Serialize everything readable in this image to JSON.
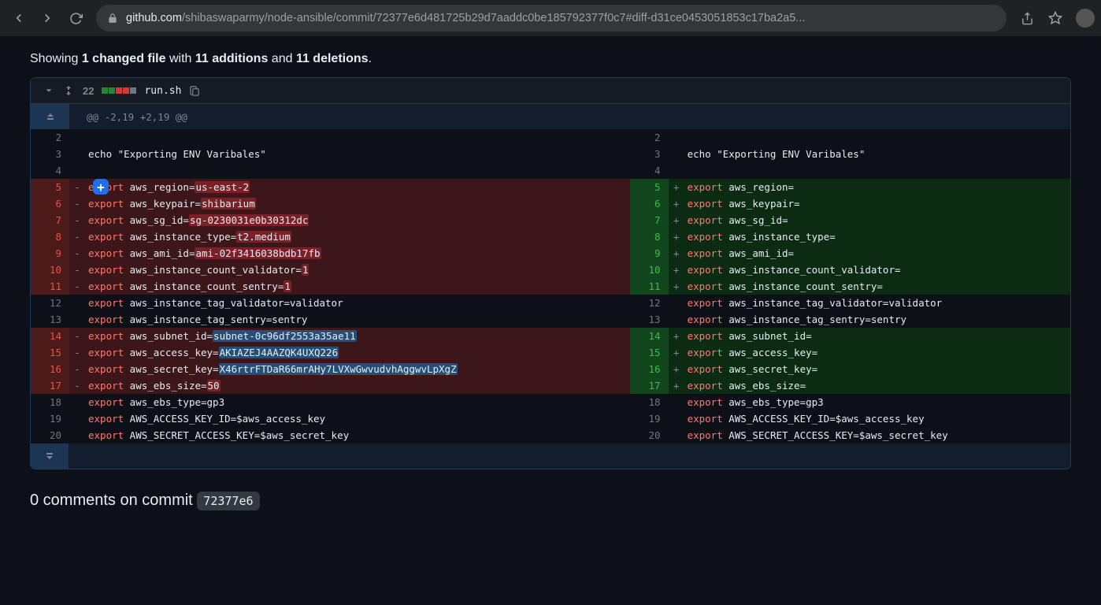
{
  "browser": {
    "url_prefix": "github.com",
    "url_path": "/shibaswaparmy/node-ansible/commit/72377e6d481725b29d7aaddc0be185792377f0c7#diff-d31ce0453051853c17ba2a5..."
  },
  "summary": {
    "prefix": "Showing ",
    "files": "1 changed file",
    "mid1": " with ",
    "adds": "11 additions",
    "mid2": " and ",
    "dels": "11 deletions",
    "suffix": "."
  },
  "file": {
    "stat_count": "22",
    "name": "run.sh"
  },
  "hunk": "@@ -2,19 +2,19 @@",
  "left": [
    {
      "n": "2",
      "m": "",
      "t": "ctx",
      "code": ""
    },
    {
      "n": "3",
      "m": "",
      "t": "ctx",
      "code": "echo \"Exporting ENV Varibales\"",
      "kw": false
    },
    {
      "n": "4",
      "m": "",
      "t": "ctx",
      "code": ""
    },
    {
      "n": "5",
      "m": "-",
      "t": "del",
      "pre": "export",
      "txt": " aws_region=",
      "hl": "us-east-2",
      "plus": true
    },
    {
      "n": "6",
      "m": "-",
      "t": "del",
      "pre": "export",
      "txt": " aws_keypair=",
      "hl": "shibarium"
    },
    {
      "n": "7",
      "m": "-",
      "t": "del",
      "pre": "export",
      "txt": " aws_sg_id=",
      "hl": "sg-0230031e0b30312dc"
    },
    {
      "n": "8",
      "m": "-",
      "t": "del",
      "pre": "export",
      "txt": " aws_instance_type=",
      "hl": "t2.medium"
    },
    {
      "n": "9",
      "m": "-",
      "t": "del",
      "pre": "export",
      "txt": " aws_ami_id=",
      "hl": "ami-02f3416038bdb17fb"
    },
    {
      "n": "10",
      "m": "-",
      "t": "del",
      "pre": "export",
      "txt": " aws_instance_count_validator=",
      "hl": "1"
    },
    {
      "n": "11",
      "m": "-",
      "t": "del",
      "pre": "export",
      "txt": " aws_instance_count_sentry=",
      "hl": "1"
    },
    {
      "n": "12",
      "m": "",
      "t": "ctx",
      "pre": "export",
      "txt": " aws_instance_tag_validator=validator"
    },
    {
      "n": "13",
      "m": "",
      "t": "ctx",
      "pre": "export",
      "txt": " aws_instance_tag_sentry=sentry"
    },
    {
      "n": "14",
      "m": "-",
      "t": "del",
      "pre": "export",
      "txt": " aws_subnet_id=",
      "sel": "subnet-0c96df2553a35ae11"
    },
    {
      "n": "15",
      "m": "-",
      "t": "del",
      "pre": "export",
      "txt": " aws_access_key=",
      "sel": "AKIAZEJ4AAZQK4UXQ226"
    },
    {
      "n": "16",
      "m": "-",
      "t": "del",
      "pre": "export",
      "txt": " aws_secret_key=",
      "sel": "X46rtrFTDaR66mrAHy7LVXwGwvudvhAggwvLpXgZ"
    },
    {
      "n": "17",
      "m": "-",
      "t": "del",
      "pre": "export",
      "txt": " aws_ebs_size=",
      "hl": "50"
    },
    {
      "n": "18",
      "m": "",
      "t": "ctx",
      "pre": "export",
      "txt": " aws_ebs_type=gp3"
    },
    {
      "n": "19",
      "m": "",
      "t": "ctx",
      "pre": "export",
      "txt": " AWS_ACCESS_KEY_ID=$aws_access_key"
    },
    {
      "n": "20",
      "m": "",
      "t": "ctx",
      "pre": "export",
      "txt": " AWS_SECRET_ACCESS_KEY=$aws_secret_key"
    }
  ],
  "right": [
    {
      "n": "2",
      "m": "",
      "t": "ctx",
      "code": ""
    },
    {
      "n": "3",
      "m": "",
      "t": "ctx",
      "code": "echo \"Exporting ENV Varibales\"",
      "kw": false
    },
    {
      "n": "4",
      "m": "",
      "t": "ctx",
      "code": ""
    },
    {
      "n": "5",
      "m": "+",
      "t": "add",
      "pre": "export",
      "txt": " aws_region="
    },
    {
      "n": "6",
      "m": "+",
      "t": "add",
      "pre": "export",
      "txt": " aws_keypair="
    },
    {
      "n": "7",
      "m": "+",
      "t": "add",
      "pre": "export",
      "txt": " aws_sg_id="
    },
    {
      "n": "8",
      "m": "+",
      "t": "add",
      "pre": "export",
      "txt": " aws_instance_type="
    },
    {
      "n": "9",
      "m": "+",
      "t": "add",
      "pre": "export",
      "txt": " aws_ami_id="
    },
    {
      "n": "10",
      "m": "+",
      "t": "add",
      "pre": "export",
      "txt": " aws_instance_count_validator="
    },
    {
      "n": "11",
      "m": "+",
      "t": "add",
      "pre": "export",
      "txt": " aws_instance_count_sentry="
    },
    {
      "n": "12",
      "m": "",
      "t": "ctx",
      "pre": "export",
      "txt": " aws_instance_tag_validator=validator"
    },
    {
      "n": "13",
      "m": "",
      "t": "ctx",
      "pre": "export",
      "txt": " aws_instance_tag_sentry=sentry"
    },
    {
      "n": "14",
      "m": "+",
      "t": "add",
      "pre": "export",
      "txt": " aws_subnet_id="
    },
    {
      "n": "15",
      "m": "+",
      "t": "add",
      "pre": "export",
      "txt": " aws_access_key="
    },
    {
      "n": "16",
      "m": "+",
      "t": "add",
      "pre": "export",
      "txt": " aws_secret_key="
    },
    {
      "n": "17",
      "m": "+",
      "t": "add",
      "pre": "export",
      "txt": " aws_ebs_size="
    },
    {
      "n": "18",
      "m": "",
      "t": "ctx",
      "pre": "export",
      "txt": " aws_ebs_type=gp3"
    },
    {
      "n": "19",
      "m": "",
      "t": "ctx",
      "pre": "export",
      "txt": " AWS_ACCESS_KEY_ID=$aws_access_key"
    },
    {
      "n": "20",
      "m": "",
      "t": "ctx",
      "pre": "export",
      "txt": " AWS_SECRET_ACCESS_KEY=$aws_secret_key"
    }
  ],
  "comments": {
    "pre": "0 comments on commit ",
    "sha": "72377e6"
  }
}
